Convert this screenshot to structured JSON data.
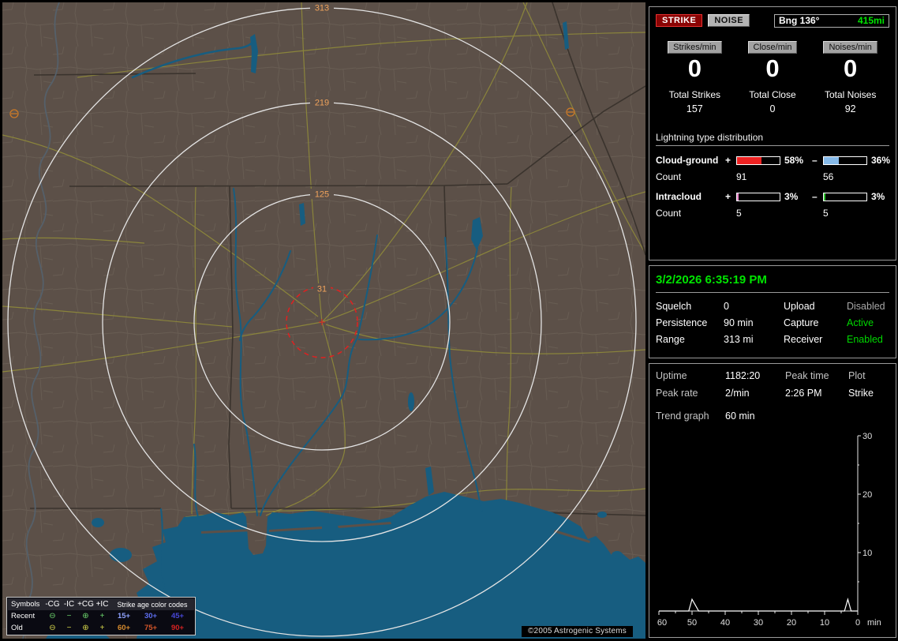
{
  "map": {
    "ring_labels": [
      "313",
      "219",
      "125",
      "31"
    ],
    "copyright": "©2005 Astrogenic Systems",
    "colors": {
      "land": "#5c5048",
      "water": "#175d80",
      "roads": "#8f8a3a",
      "range_rings": "#e4e4e4",
      "alarm_ring": "#e02020",
      "ring_label": "#f0a35c"
    },
    "strike_symbols": [
      {
        "type": "negative-cg",
        "age": "old"
      },
      {
        "type": "negative-cg",
        "age": "old"
      }
    ],
    "legend": {
      "symbols_header": "Symbols",
      "type_columns": [
        "-CG",
        "-IC",
        "+CG",
        "+IC"
      ],
      "symbols": [
        "⊖",
        "−",
        "⊕",
        "+"
      ],
      "age_header": "Strike age color codes",
      "recent_label": "Recent",
      "old_label": "Old",
      "recent_color": "#6cd46c",
      "old_color": "#d4d44a",
      "recent_ages": [
        {
          "text": "15+",
          "color": "#8fa2ff"
        },
        {
          "text": "30+",
          "color": "#5d6ef0"
        },
        {
          "text": "45+",
          "color": "#4747d8"
        }
      ],
      "old_ages": [
        {
          "text": "60+",
          "color": "#d58a2e"
        },
        {
          "text": "75+",
          "color": "#d4562a"
        },
        {
          "text": "90+",
          "color": "#d42222"
        }
      ]
    }
  },
  "sidebar": {
    "controls": {
      "strike_button": "STRIKE",
      "noise_button": "NOISE",
      "bearing": "Bng 136°",
      "bearing_distance": "415mi"
    },
    "rates": {
      "columns": [
        {
          "header": "Strikes/min",
          "value": "0",
          "total_label": "Total Strikes",
          "total_value": "157"
        },
        {
          "header": "Close/min",
          "value": "0",
          "total_label": "Total Close",
          "total_value": "0"
        },
        {
          "header": "Noises/min",
          "value": "0",
          "total_label": "Total Noises",
          "total_value": "92"
        }
      ]
    },
    "distribution": {
      "title": "Lightning type distribution",
      "rows": [
        {
          "label": "Cloud-ground",
          "plus_sign": "+",
          "plus_fill": 58,
          "plus_color": "#ee2222",
          "plus_pct": "58%",
          "minus_sign": "–",
          "minus_fill": 36,
          "minus_color": "#85b9e8",
          "minus_pct": "36%",
          "count_label": "Count",
          "plus_count": "91",
          "minus_count": "56"
        },
        {
          "label": "Intracloud",
          "plus_sign": "+",
          "plus_fill": 3,
          "plus_color": "#ee86cc",
          "plus_pct": "3%",
          "minus_sign": "–",
          "minus_fill": 3,
          "minus_color": "#2cc42c",
          "minus_pct": "3%",
          "count_label": "Count",
          "plus_count": "5",
          "minus_count": "5"
        }
      ]
    },
    "status": {
      "datetime": "3/2/2026 6:35:19 PM",
      "rows": [
        {
          "label1": "Squelch",
          "value1": "0",
          "label2": "Upload",
          "value2": "Disabled",
          "value2_color": "#a8a8a8"
        },
        {
          "label1": "Persistence",
          "value1": "90 min",
          "label2": "Capture",
          "value2": "Active",
          "value2_color": "#00d800"
        },
        {
          "label1": "Range",
          "value1": "313 mi",
          "label2": "Receiver",
          "value2": "Enabled",
          "value2_color": "#00d800"
        }
      ]
    },
    "session": {
      "uptime_label": "Uptime",
      "uptime_value": "1182:20",
      "peak_time_label": "Peak time",
      "plot_label": "Plot",
      "peak_rate_label": "Peak rate",
      "peak_rate_value": "2/min",
      "peak_time_value": "2:26 PM",
      "plot_value": "Strike",
      "trend_label": "Trend graph",
      "trend_value": "60 min"
    }
  },
  "chart_data": {
    "type": "line",
    "title": "Strike trend graph (last 60 min)",
    "x_unit": "min",
    "x_ticks": [
      60,
      50,
      40,
      30,
      20,
      10,
      0
    ],
    "y_ticks": [
      30,
      20,
      10
    ],
    "ylim": [
      0,
      30
    ],
    "xlim_minutes_ago": [
      60,
      0
    ],
    "grid": false,
    "legend_position": "none",
    "series": [
      {
        "name": "Strike",
        "baseline": 0,
        "points_minutes_ago": [
          [
            50,
            2
          ],
          [
            49,
            1
          ],
          [
            3,
            2
          ]
        ]
      }
    ]
  }
}
